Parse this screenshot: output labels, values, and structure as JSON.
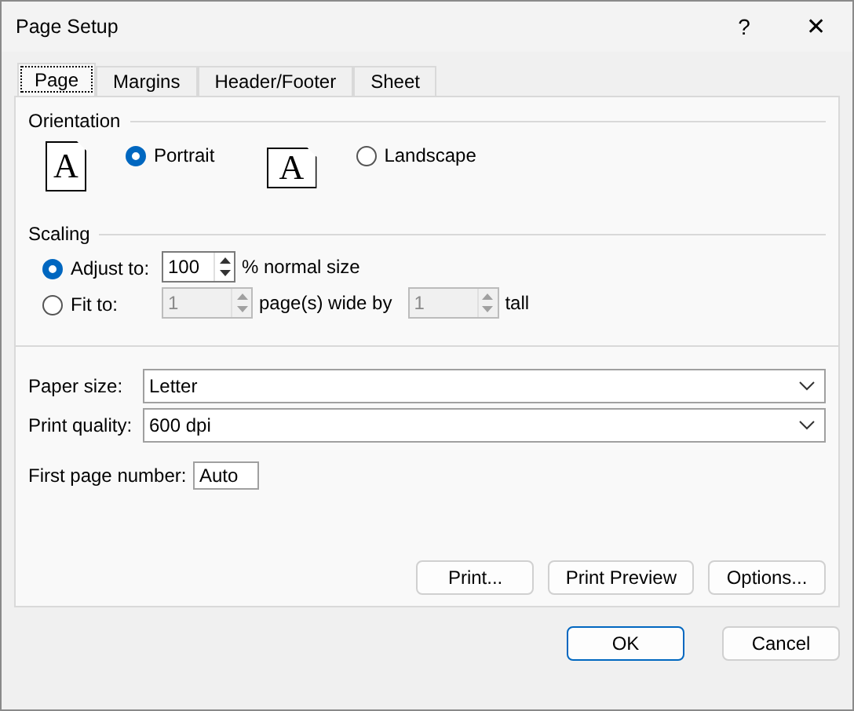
{
  "window": {
    "title": "Page Setup",
    "help": "?",
    "close": "✕"
  },
  "tabs": [
    {
      "label": "Page",
      "selected": true
    },
    {
      "label": "Margins",
      "selected": false
    },
    {
      "label": "Header/Footer",
      "selected": false
    },
    {
      "label": "Sheet",
      "selected": false
    }
  ],
  "orientation": {
    "heading": "Orientation",
    "options": [
      {
        "label": "Portrait",
        "icon_letter": "A",
        "kind": "portrait",
        "selected": true
      },
      {
        "label": "Landscape",
        "icon_letter": "A",
        "kind": "landscape",
        "selected": false
      }
    ]
  },
  "scaling": {
    "heading": "Scaling",
    "options": [
      {
        "label": "Adjust to:",
        "selected": true,
        "fields": [
          {
            "value": "100",
            "disabled": false,
            "suffix": "% normal size"
          }
        ]
      },
      {
        "label": "Fit to:",
        "selected": false,
        "fields": [
          {
            "value": "1",
            "disabled": true,
            "suffix": "page(s) wide by"
          },
          {
            "value": "1",
            "disabled": true,
            "suffix": "tall"
          }
        ]
      }
    ]
  },
  "paper_size": {
    "label": "Paper size:",
    "value": "Letter"
  },
  "print_quality": {
    "label": "Print quality:",
    "value": "600 dpi"
  },
  "first_page_number": {
    "label": "First page number:",
    "value": "Auto"
  },
  "panel_buttons": [
    "Print...",
    "Print Preview",
    "Options..."
  ],
  "buttons": [
    {
      "label": "OK",
      "default": true
    },
    {
      "label": "Cancel",
      "default": false
    }
  ]
}
